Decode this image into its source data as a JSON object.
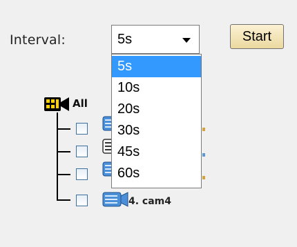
{
  "interval": {
    "label": "Interval:",
    "selected_value": "5s",
    "options": [
      "5s",
      "10s",
      "20s",
      "30s",
      "45s",
      "60s"
    ]
  },
  "start_button": {
    "label": "Start"
  },
  "tree": {
    "root": {
      "label": "All",
      "icon": "camera-group-icon"
    },
    "items": [
      {
        "label": "",
        "checked": false,
        "icon": "camera-icon"
      },
      {
        "label": "",
        "checked": false,
        "icon": "camera-icon"
      },
      {
        "label": "",
        "checked": false,
        "icon": "camera-icon"
      },
      {
        "label": "4. cam4",
        "checked": false,
        "icon": "camera-icon"
      }
    ]
  },
  "colors": {
    "background": "#f0f0f0",
    "selection": "#3399ff",
    "camera_blue": "#4a8fd8",
    "checkbox_border": "#3d6f9c"
  }
}
